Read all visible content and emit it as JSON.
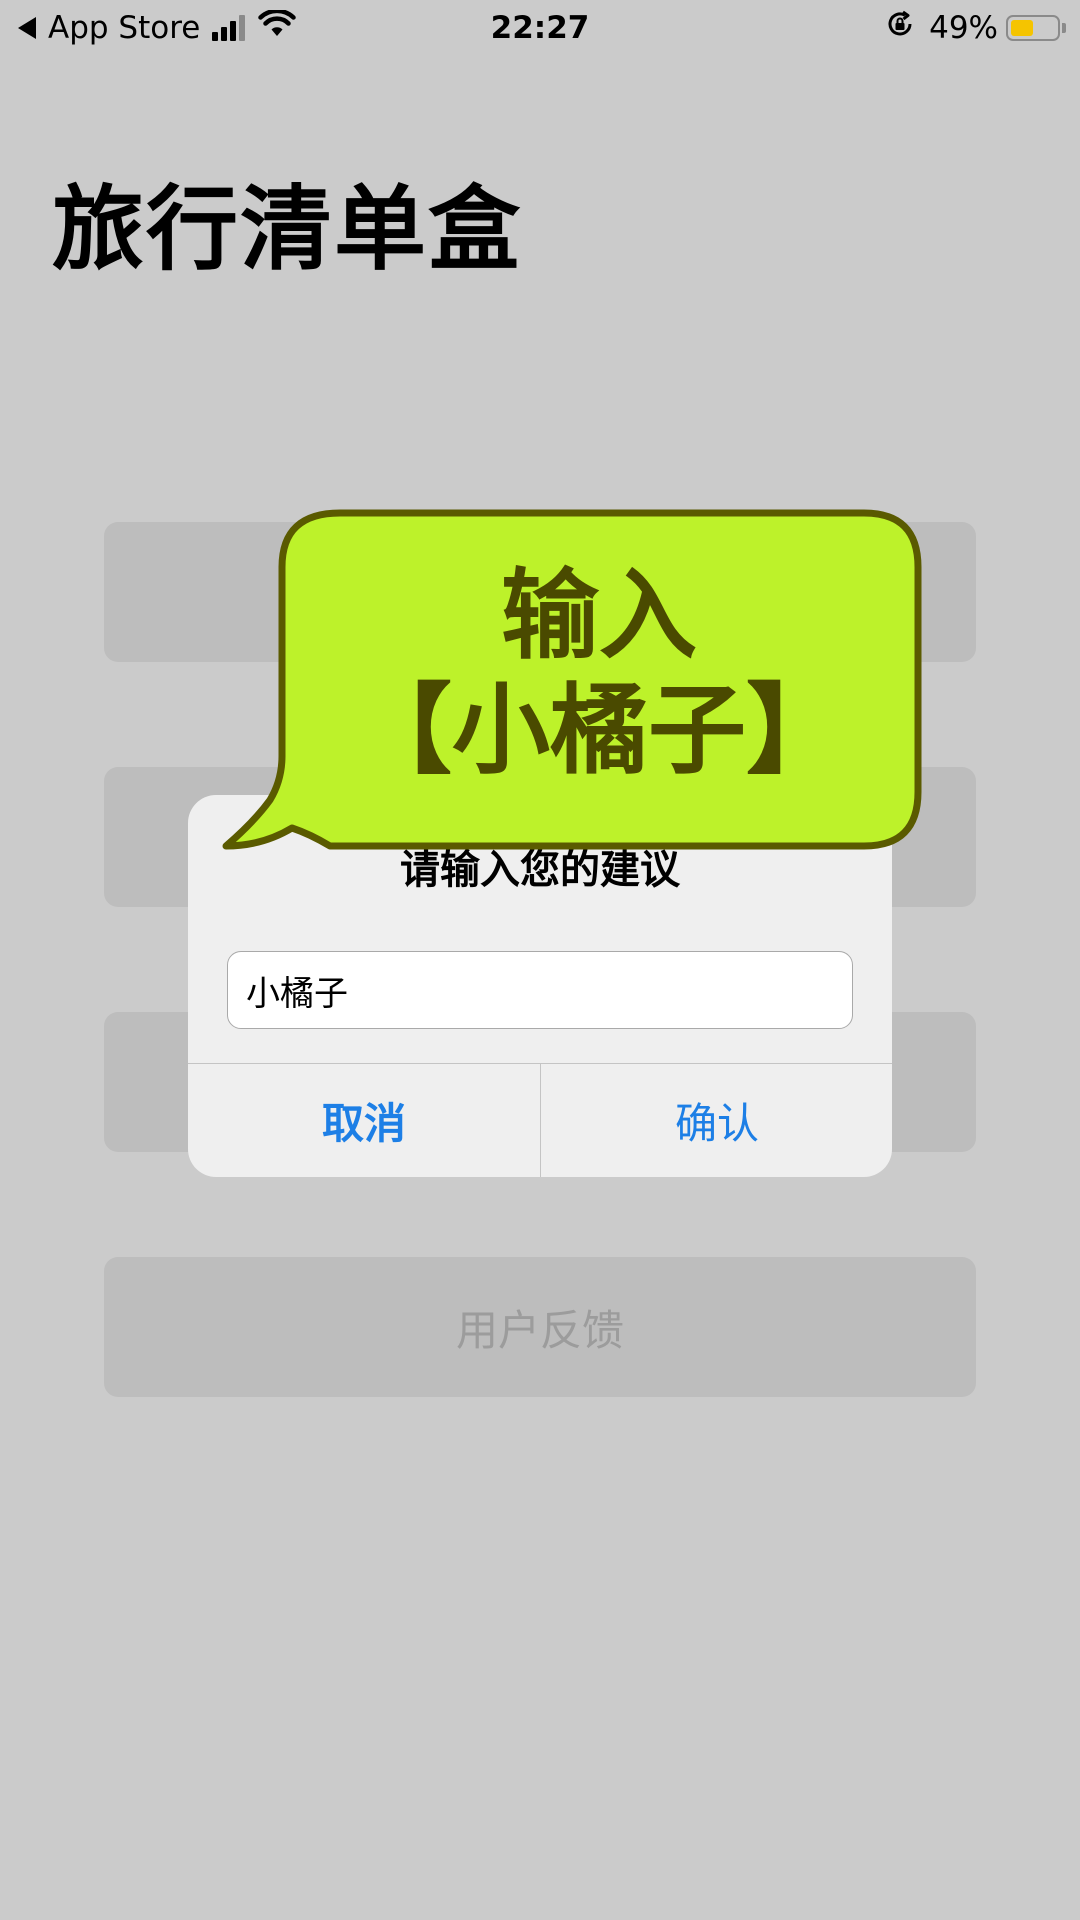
{
  "status_bar": {
    "back_app": "App Store",
    "time": "22:27",
    "battery_percent": "49%",
    "battery_level": 0.49,
    "icons": [
      "back-arrow-icon",
      "cellular-signal-icon",
      "wifi-icon",
      "rotation-lock-icon",
      "battery-icon"
    ]
  },
  "page": {
    "title": "旅行清单盒",
    "buttons": [
      {
        "label": ""
      },
      {
        "label": ""
      },
      {
        "label": ""
      },
      {
        "label": "用户反馈"
      }
    ]
  },
  "alert": {
    "title": "请输入您的建议",
    "input_value": "小橘子",
    "cancel_label": "取消",
    "confirm_label": "确认"
  },
  "annotation": {
    "line1": "输入",
    "line2": "【小橘子】"
  },
  "colors": {
    "background": "#cbcbcb",
    "button_bg": "#bdbdbd",
    "alert_bg": "#efefef",
    "link_blue": "#1d7fe6",
    "bubble_fill": "#bdf22a",
    "bubble_stroke": "#5a5a00",
    "battery_fill": "#f5c400"
  }
}
